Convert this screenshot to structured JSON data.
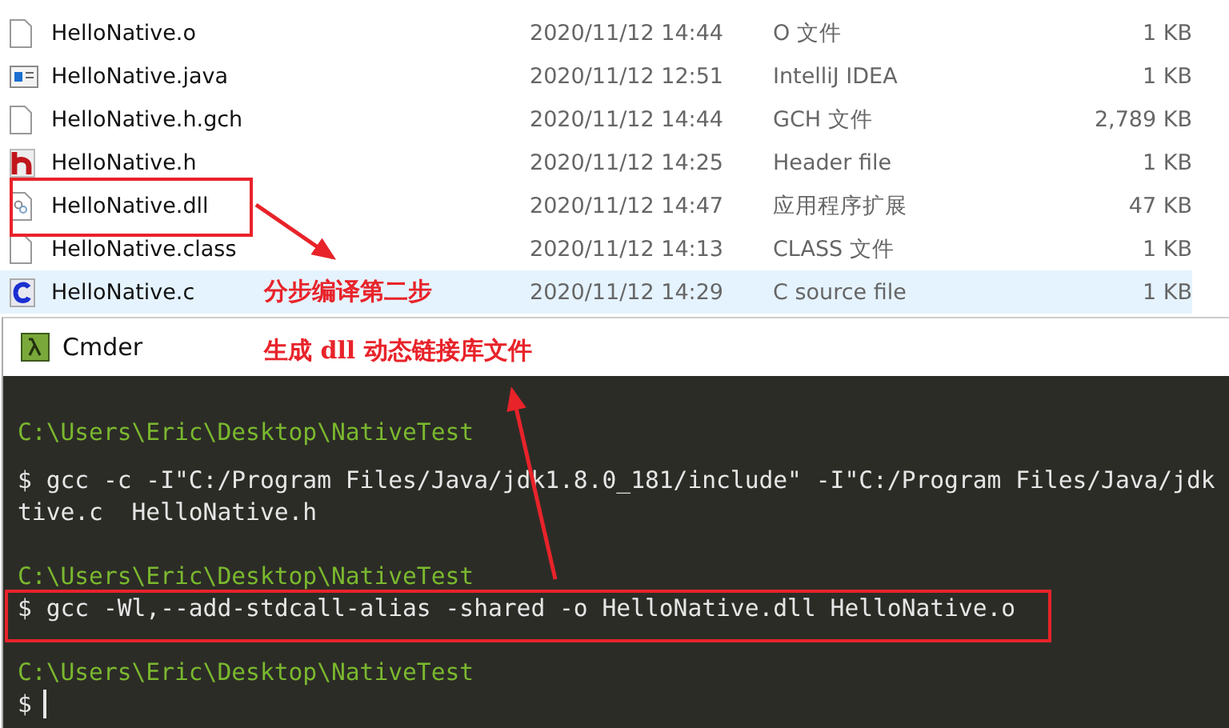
{
  "files": [
    {
      "kind": "blank",
      "name": "HelloNative.o",
      "date": "2020/11/12 14:44",
      "type": "O 文件",
      "size": "1 KB",
      "selected": false
    },
    {
      "kind": "java",
      "name": "HelloNative.java",
      "date": "2020/11/12 12:51",
      "type": "IntelliJ IDEA",
      "size": "1 KB",
      "selected": false
    },
    {
      "kind": "blank",
      "name": "HelloNative.h.gch",
      "date": "2020/11/12 14:44",
      "type": "GCH 文件",
      "size": "2,789 KB",
      "selected": false
    },
    {
      "kind": "header",
      "name": "HelloNative.h",
      "date": "2020/11/12 14:25",
      "type": "Header file",
      "size": "1 KB",
      "selected": false
    },
    {
      "kind": "dll",
      "name": "HelloNative.dll",
      "date": "2020/11/12 14:47",
      "type": "应用程序扩展",
      "size": "47 KB",
      "selected": false
    },
    {
      "kind": "blank",
      "name": "HelloNative.class",
      "date": "2020/11/12 14:13",
      "type": "CLASS 文件",
      "size": "1 KB",
      "selected": false
    },
    {
      "kind": "csource",
      "name": "HelloNative.c",
      "date": "2020/11/12 14:29",
      "type": "C source file",
      "size": "1 KB",
      "selected": true
    }
  ],
  "terminal": {
    "title": "Cmder",
    "lines": [
      {
        "kind": "prompt",
        "text": "C:\\Users\\Eric\\Desktop\\NativeTest"
      },
      {
        "kind": "output",
        "text": "$ gcc -c -I\"C:/Program Files/Java/jdk1.8.0_181/include\" -I\"C:/Program Files/Java/jdk"
      },
      {
        "kind": "output",
        "text": "tive.c  HelloNative.h"
      },
      {
        "kind": "blank"
      },
      {
        "kind": "prompt",
        "text": "C:\\Users\\Eric\\Desktop\\NativeTest"
      },
      {
        "kind": "output",
        "text": "$ gcc -Wl,--add-stdcall-alias -shared -o HelloNative.dll HelloNative.o"
      },
      {
        "kind": "blank"
      },
      {
        "kind": "prompt",
        "text": "C:\\Users\\Eric\\Desktop\\NativeTest"
      },
      {
        "kind": "cursor",
        "text": "$"
      }
    ]
  },
  "annotations": [
    {
      "text": "分步编译第二步"
    },
    {
      "text": "生成 dll 动态链接库文件"
    }
  ]
}
